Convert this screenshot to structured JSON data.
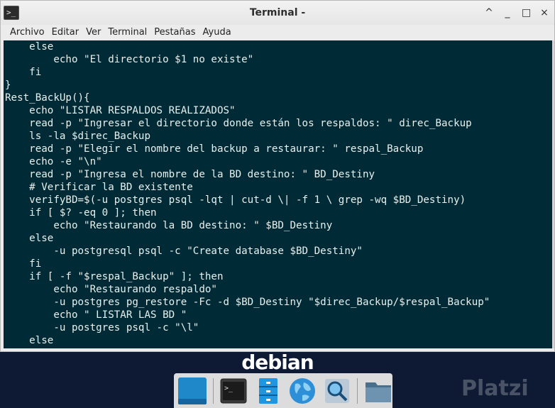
{
  "window": {
    "title": "Terminal -",
    "controls": {
      "minimize_up": "^",
      "minimize": "_",
      "maximize": "□",
      "close": "×"
    }
  },
  "menubar": [
    "Archivo",
    "Editar",
    "Ver",
    "Terminal",
    "Pestañas",
    "Ayuda"
  ],
  "terminal": {
    "lines": [
      "    else",
      "        echo \"El directorio $1 no existe\"",
      "    fi",
      "}",
      "Rest_BackUp(){",
      "    echo \"LISTAR RESPALDOS REALIZADOS\"",
      "    read -p \"Ingresar el directorio donde están los respaldos: \" direc_Backup",
      "    ls -la $direc_Backup",
      "    read -p \"Elegir el nombre del backup a restaurar: \" respal_Backup",
      "    echo -e \"\\n\"",
      "    read -p \"Ingresa el nombre de la BD destino: \" BD_Destiny",
      "    # Verificar la BD existente",
      "    verifyBD=$(-u postgres psql -lqt | cut-d \\| -f 1 \\ grep -wq $BD_Destiny)",
      "    if [ $? -eq 0 ]; then",
      "        echo \"Restaurando la BD destino: \" $BD_Destiny",
      "    else",
      "        -u postgresql psql -c \"Create database $BD_Destiny\"",
      "    fi",
      "    if [ -f \"$respal_Backup\" ]; then",
      "        echo \"Restaurando respaldo\"",
      "        -u postgres pg_restore -Fc -d $BD_Destiny \"$direc_Backup/$respal_Backup\"",
      "        echo \" LISTAR LAS BD \"",
      "        -u postgres psql -c \"\\l\"",
      "    else"
    ]
  },
  "desktop": {
    "brand": "debian",
    "watermark": "Platzi"
  },
  "dock": {
    "items": [
      {
        "name": "show-desktop",
        "icon": "desktop-icon"
      },
      {
        "name": "terminal",
        "icon": "terminal-icon"
      },
      {
        "name": "file-cabinet",
        "icon": "file-cabinet-icon"
      },
      {
        "name": "web-browser",
        "icon": "globe-icon"
      },
      {
        "name": "app-finder",
        "icon": "magnifier-icon"
      },
      {
        "name": "files",
        "icon": "folder-icon"
      }
    ]
  },
  "colors": {
    "terminal_bg": "#002b36",
    "terminal_fg": "#e8f0ee",
    "desktop_bg": "#0e1a33",
    "dock_bg": "#dcdcdc"
  }
}
